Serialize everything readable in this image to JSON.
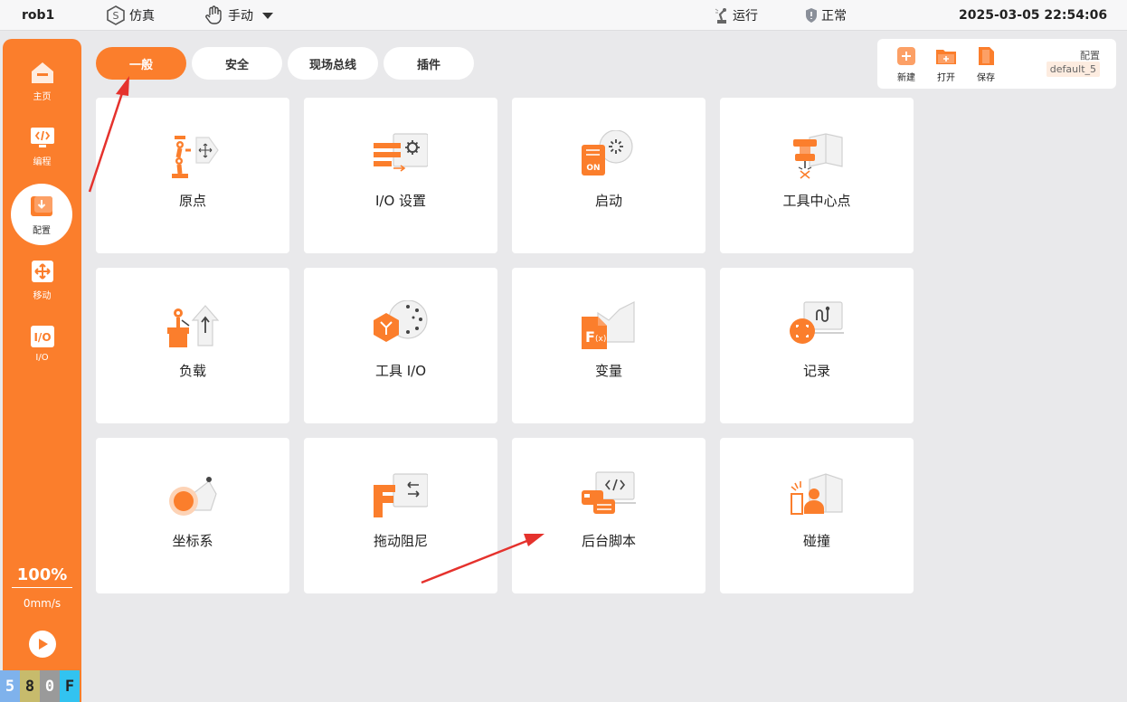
{
  "topbar": {
    "robot_name": "rob1",
    "sim_label": "仿真",
    "manual_label": "手动",
    "run_label": "运行",
    "status_label": "正常",
    "datetime": "2025-03-05 22:54:06"
  },
  "sidebar": {
    "items": [
      {
        "label": "主页",
        "icon": "home-icon"
      },
      {
        "label": "编程",
        "icon": "code-icon"
      },
      {
        "label": "配置",
        "icon": "config-icon"
      },
      {
        "label": "移动",
        "icon": "move-icon"
      },
      {
        "label": "I/O",
        "icon": "io-icon"
      }
    ],
    "speed_percent": "100%",
    "speed_mms": "0mm/s",
    "badges": [
      "5",
      "8",
      "0",
      "F"
    ]
  },
  "tabs": [
    {
      "label": "一般",
      "active": true
    },
    {
      "label": "安全",
      "active": false
    },
    {
      "label": "现场总线",
      "active": false
    },
    {
      "label": "插件",
      "active": false
    }
  ],
  "toolbar": {
    "new_label": "新建",
    "open_label": "打开",
    "save_label": "保存",
    "config_label": "配置",
    "config_value": "default_5"
  },
  "cards": [
    {
      "label": "原点",
      "icon": "origin-icon"
    },
    {
      "label": "I/O 设置",
      "icon": "io-settings-icon"
    },
    {
      "label": "启动",
      "icon": "startup-icon"
    },
    {
      "label": "工具中心点",
      "icon": "tcp-icon"
    },
    {
      "label": "负载",
      "icon": "payload-icon"
    },
    {
      "label": "工具 I/O",
      "icon": "tool-io-icon"
    },
    {
      "label": "变量",
      "icon": "variables-icon"
    },
    {
      "label": "记录",
      "icon": "log-icon"
    },
    {
      "label": "坐标系",
      "icon": "coordinate-icon"
    },
    {
      "label": "拖动阻尼",
      "icon": "drag-damping-icon"
    },
    {
      "label": "后台脚本",
      "icon": "background-script-icon"
    },
    {
      "label": "碰撞",
      "icon": "collision-icon"
    }
  ],
  "colors": {
    "accent": "#fb7e2c",
    "background": "#e9e9eb",
    "annotation": "#e5322d"
  }
}
